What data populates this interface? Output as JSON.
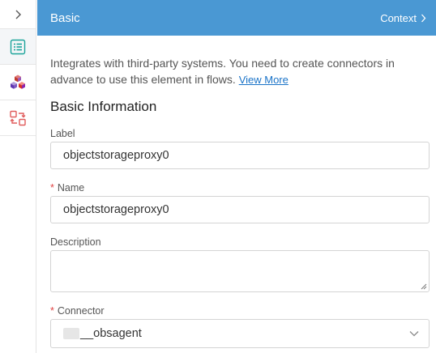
{
  "sidebar": {
    "items": [
      {
        "icon": "list-icon",
        "active": true
      },
      {
        "icon": "cubes-icon",
        "active": false
      },
      {
        "icon": "transfer-icon",
        "active": false
      }
    ]
  },
  "header": {
    "title": "Basic",
    "context_label": "Context"
  },
  "main": {
    "description": "Integrates with third-party systems. You need to create connectors in advance to use this element in flows.",
    "view_more": "View More",
    "section_title": "Basic Information",
    "fields": {
      "label": {
        "label": "Label",
        "value": "objectstorageproxy0"
      },
      "name": {
        "label": "Name",
        "value": "objectstorageproxy0",
        "required": true
      },
      "description": {
        "label": "Description",
        "value": ""
      },
      "connector": {
        "label": "Connector",
        "value": "__obsagent",
        "required": true
      }
    }
  },
  "colors": {
    "header_bg": "#4a98d3",
    "link": "#1a73c8",
    "required": "#e04545",
    "icon_active": "#1aa39a",
    "icon_transfer": "#e05c5c"
  }
}
